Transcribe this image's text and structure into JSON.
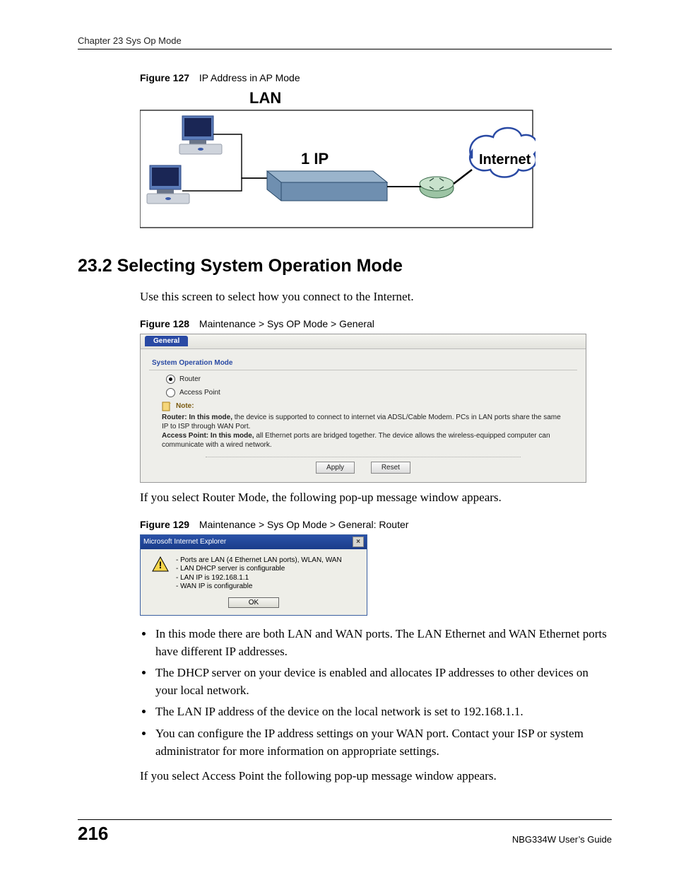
{
  "header": {
    "chapter": "Chapter 23 Sys Op Mode"
  },
  "fig127": {
    "label": "Figure 127",
    "caption": "IP Address in AP Mode",
    "diagram": {
      "lan": "LAN",
      "oneip": "1 IP",
      "internet": "Internet"
    }
  },
  "section": {
    "number_title": "23.2  Selecting System Operation Mode",
    "intro": "Use this screen to select how you connect to the Internet."
  },
  "fig128": {
    "label": "Figure 128",
    "caption": "Maintenance > Sys OP Mode > General",
    "tab": "General",
    "panel_title": "System Operation Mode",
    "radio_router": "Router",
    "radio_ap": "Access Point",
    "note_label": "Note:",
    "note_router": "Router: In this mode, the device is supported to connect to internet via ADSL/Cable Modem. PCs in LAN ports share the same IP to ISP through WAN Port.",
    "note_ap": "Access Point: In this mode, all Ethernet ports are bridged together. The device allows the wireless-equipped computer can communicate with a wired network.",
    "apply": "Apply",
    "reset": "Reset"
  },
  "after128": "If you select Router Mode, the following pop-up message window appears.",
  "fig129": {
    "label": "Figure 129",
    "caption": "Maintenance > Sys Op Mode > General: Router",
    "title": "Microsoft Internet Explorer",
    "lines": [
      "- Ports are LAN (4 Ethernet LAN ports), WLAN, WAN",
      "- LAN DHCP server is configurable",
      "- LAN IP is 192.168.1.1",
      "- WAN IP is configurable"
    ],
    "ok": "OK"
  },
  "bullets": [
    "In this mode there are both LAN and WAN ports. The LAN Ethernet and WAN Ethernet ports have different IP addresses.",
    "The DHCP server on your device is enabled and allocates IP addresses to other devices on your local network.",
    "The LAN IP address of the device on the local network is set to 192.168.1.1.",
    "You can configure the IP address settings on your WAN port. Contact your ISP or system administrator for more information on appropriate settings."
  ],
  "afterbullets": "If you select Access Point the following pop-up message window appears.",
  "footer": {
    "page": "216",
    "guide": "NBG334W User’s Guide"
  }
}
